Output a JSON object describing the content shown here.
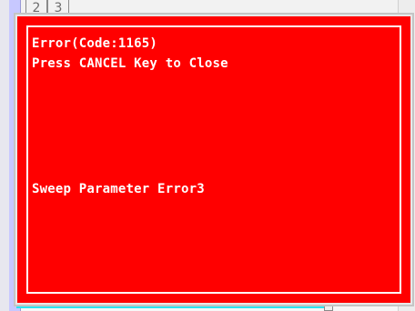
{
  "background": {
    "tabs": [
      "2",
      "3"
    ]
  },
  "error_dialog": {
    "title_line": "Error(Code:1165)",
    "instruction_line": "Press CANCEL Key to Close",
    "message_line": "Sweep Parameter Error3"
  },
  "colors": {
    "dialog_red": "#ff0000",
    "dialog_text": "#ffffff",
    "accent_cyan": "#2de3f0",
    "accent_lavender": "#c7c8ff"
  }
}
